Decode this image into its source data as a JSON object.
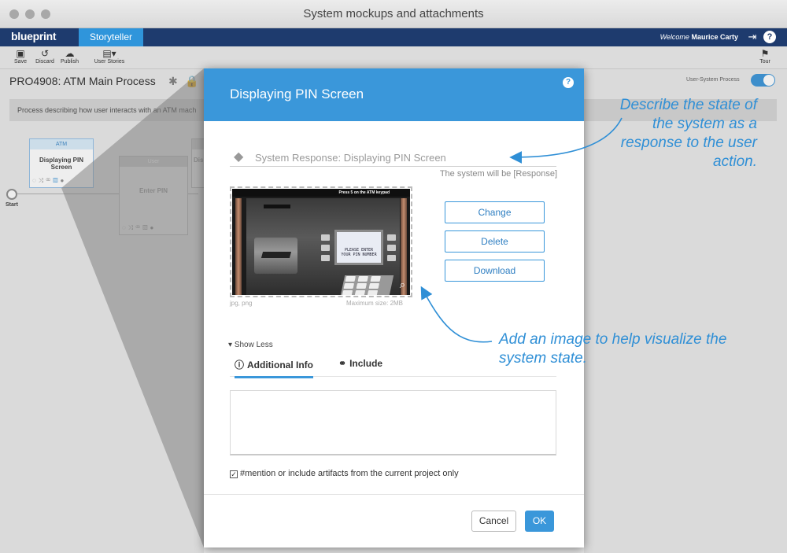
{
  "window": {
    "title": "System mockups and attachments"
  },
  "header": {
    "logo": "blueprint",
    "active_tab": "Storyteller",
    "welcome_prefix": "Welcome",
    "user_name": "Maurice Carty"
  },
  "toolbar": {
    "save": "Save",
    "discard": "Discard",
    "publish": "Publish",
    "user_stories": "User Stories",
    "tour": "Tour"
  },
  "page": {
    "title": "PRO4908: ATM Main Process",
    "toggle_label": "User-System Process",
    "toggle_on": true,
    "description": "Process describing how user interacts with an ATM mach"
  },
  "diagram": {
    "start_label": "Start",
    "nodes": [
      {
        "header": "ATM",
        "title": "Displaying PIN Screen"
      },
      {
        "header": "User",
        "title": "Enter PIN"
      },
      {
        "header": "",
        "title": "Dis"
      }
    ]
  },
  "dialog": {
    "title": "Displaying PIN Screen",
    "response_field": "System Response: Displaying PIN Screen",
    "response_hint": "The system will be [Response]",
    "image": {
      "atm_caption": "Press 5 on the ATM keypad",
      "screen_text_1": "PLEASE ENTER",
      "screen_text_2": "YOUR PIN NUMBER",
      "formats": "jpg, png",
      "max_size": "Maximum size: 2MB"
    },
    "buttons": {
      "change": "Change",
      "delete": "Delete",
      "download": "Download"
    },
    "show_less": "Show Less",
    "tabs": [
      {
        "label": "Additional Info"
      },
      {
        "label": "Include"
      }
    ],
    "checkbox_label": "#mention or include artifacts from the current project only",
    "checkbox_checked": true,
    "cancel": "Cancel",
    "ok": "OK"
  },
  "annotations": {
    "top_right": [
      "Describe the state of",
      "the system as a",
      "response to the user",
      "action."
    ],
    "bottom_right": [
      "Add an image to help visualize the",
      "system state."
    ]
  },
  "colors": {
    "brand_dark": "#1e3b6e",
    "accent": "#3a97da",
    "annotation": "#2f8fd6"
  }
}
